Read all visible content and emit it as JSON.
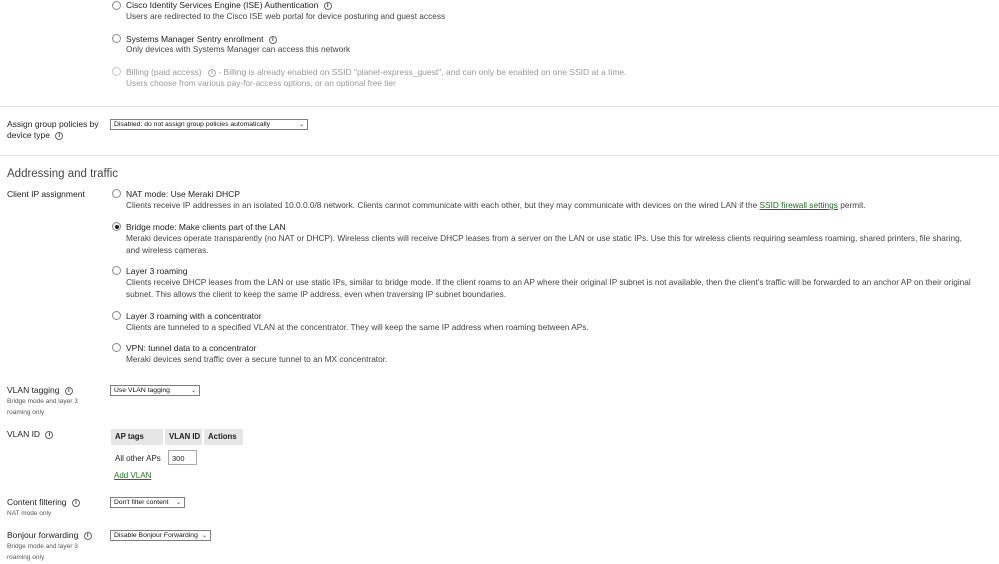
{
  "splash_options": [
    {
      "title": "Cisco Identity Services Engine (ISE) Authentication",
      "desc": "Users are redirected to the Cisco ISE web portal for device posturing and guest access",
      "disabled": false
    },
    {
      "title": "Systems Manager Sentry enrollment",
      "desc": "Only devices with Systems Manager can access this network",
      "disabled": false
    },
    {
      "title": "Billing (paid access)",
      "note": "- Billing is already enabled on SSID \"planet-express_guest\", and can only be enabled on one SSID at a time.",
      "desc": "Users choose from various pay-for-access options, or an optional free tier",
      "disabled": true
    }
  ],
  "group_policy": {
    "label_line1": "Assign group policies by",
    "label_line2": "device type",
    "selected": "Disabled: do not assign group policies automatically"
  },
  "addressing": {
    "title": "Addressing and traffic",
    "client_ip_label": "Client IP assignment",
    "modes": [
      {
        "title": "NAT mode: Use Meraki DHCP",
        "desc_pre": "Clients receive IP addresses in an isolated 10.0.0.0/8 network. Clients cannot communicate with each other, but they may communicate with devices on the wired LAN if the ",
        "link": "SSID firewall settings",
        "desc_post": " permit.",
        "checked": false
      },
      {
        "title": "Bridge mode: Make clients part of the LAN",
        "desc": "Meraki devices operate transparently (no NAT or DHCP). Wireless clients will receive DHCP leases from a server on the LAN or use static IPs. Use this for wireless clients requiring seamless roaming, shared printers, file sharing, and wireless cameras.",
        "checked": true
      },
      {
        "title": "Layer 3 roaming",
        "desc": "Clients receive DHCP leases from the LAN or use static IPs, similar to bridge mode. If the client roams to an AP where their original IP subnet is not available, then the client's traffic will be forwarded to an anchor AP on their original subnet. This allows the client to keep the same IP address, even when traversing IP subnet boundaries.",
        "checked": false
      },
      {
        "title": "Layer 3 roaming with a concentrator",
        "desc": "Clients are tunneled to a specified VLAN at the concentrator. They will keep the same IP address when roaming between APs.",
        "checked": false
      },
      {
        "title": "VPN: tunnel data to a concentrator",
        "desc": "Meraki devices send traffic over a secure tunnel to an MX concentrator.",
        "checked": false
      }
    ]
  },
  "vlan_tagging": {
    "label": "VLAN tagging",
    "sub_line1": "Bridge mode and layer 3",
    "sub_line2": "roaming only",
    "selected": "Use VLAN tagging"
  },
  "vlan_id": {
    "label": "VLAN ID",
    "headers": [
      "AP tags",
      "VLAN ID",
      "Actions"
    ],
    "row_label": "All other APs",
    "row_value": "300",
    "add_label": "Add VLAN"
  },
  "content_filtering": {
    "label": "Content filtering",
    "sub": "NAT mode only",
    "selected": "Don't filter content"
  },
  "bonjour": {
    "label": "Bonjour forwarding",
    "sub_line1": "Bridge mode and layer 3",
    "sub_line2": "roaming only",
    "selected": "Disable Bonjour Forwarding"
  },
  "icons": {
    "info": "info-icon",
    "chevron": "chevron-down-icon"
  },
  "colors": {
    "link": "#1a6f1a",
    "divider": "#e3e3e3",
    "header_bg": "#e6e6e6"
  }
}
